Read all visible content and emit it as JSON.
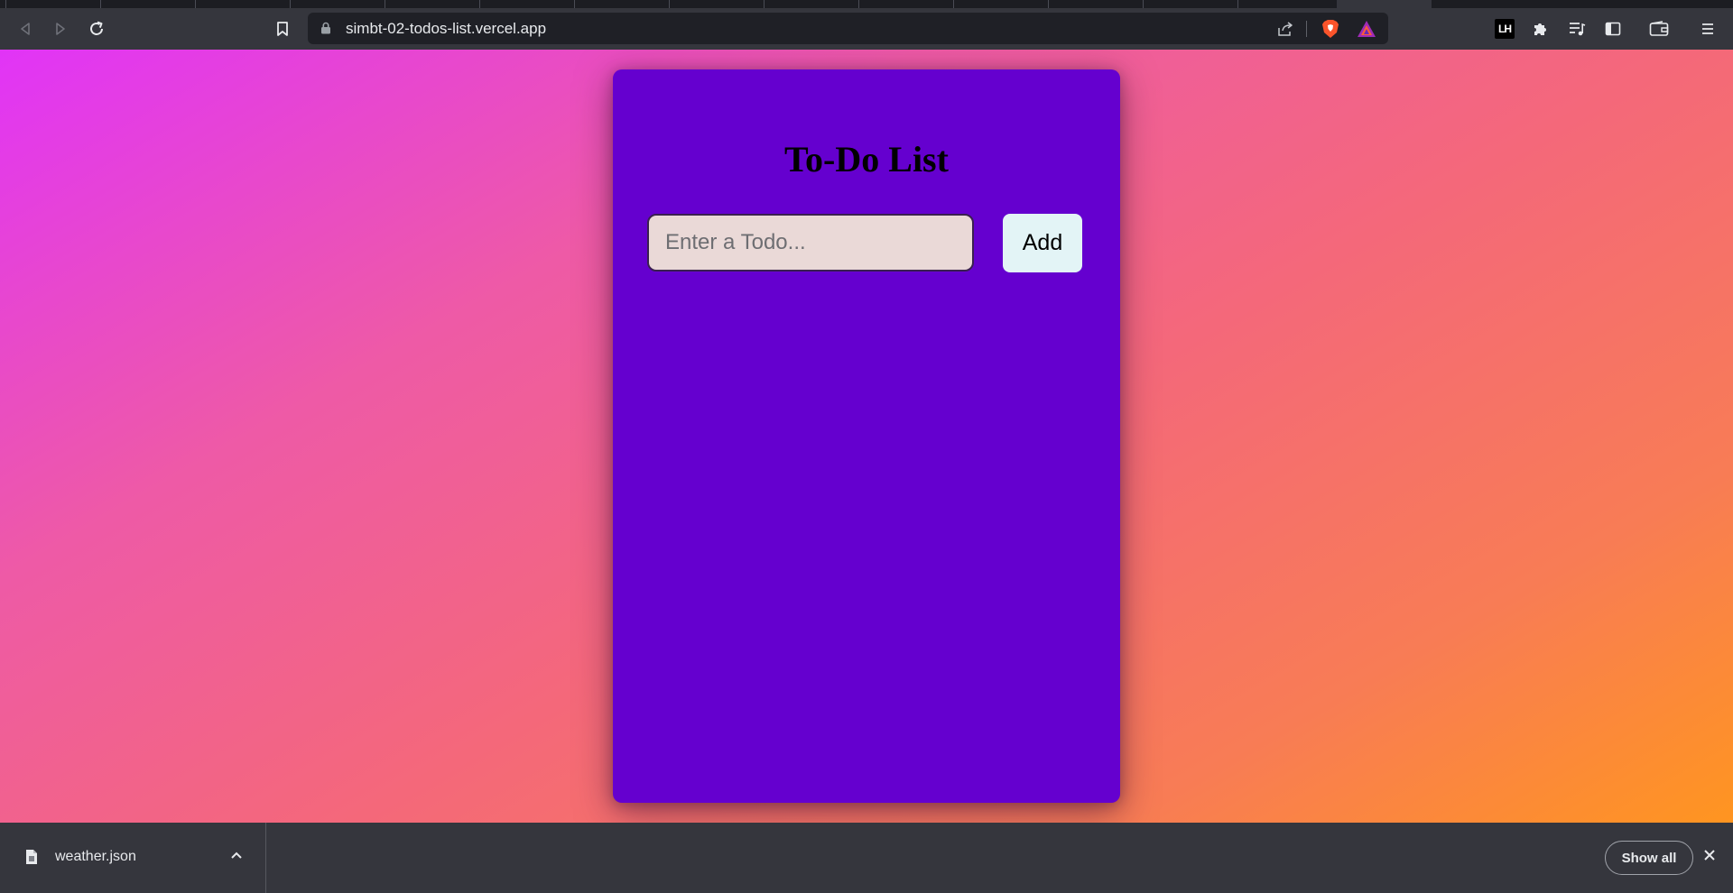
{
  "browser": {
    "url": "simbt-02-todos-list.vercel.app",
    "icons": {
      "back": "back-icon",
      "forward": "forward-icon",
      "reload": "reload-icon",
      "bookmark": "bookmark-icon",
      "lock": "lock-icon",
      "share": "share-icon",
      "brave_shield": "brave-shield-icon",
      "brave_rewards": "brave-rewards-icon",
      "lighthouse_ext": "lighthouse-extension-icon",
      "extensions": "puzzle-icon",
      "media": "playlist-icon",
      "sidebar": "sidebar-icon",
      "wallet": "wallet-icon",
      "menu": "hamburger-menu-icon"
    },
    "lighthouse_badge": "LH"
  },
  "page": {
    "title": "To-Do List",
    "input_placeholder": "Enter a Todo...",
    "input_value": "",
    "add_label": "Add",
    "todos": []
  },
  "downloads": {
    "items": [
      {
        "filename": "weather.json"
      }
    ],
    "show_all_label": "Show all"
  },
  "colors": {
    "card": "#6500cf",
    "input_bg": "#ead9d7",
    "button_bg": "#e3f4f6",
    "gradient_start": "#e134f7",
    "gradient_end": "#ff9520",
    "chrome": "#35363d"
  }
}
